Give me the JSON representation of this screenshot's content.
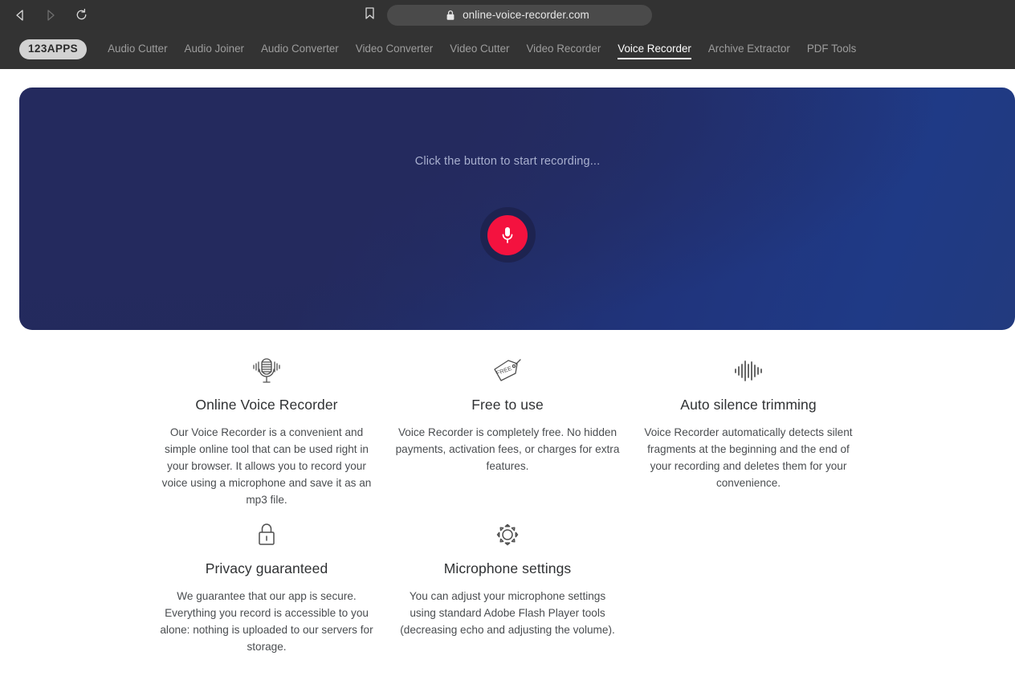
{
  "browser": {
    "back_icon": "back-arrow-icon",
    "forward_icon": "forward-arrow-icon",
    "reload_icon": "reload-icon",
    "bookmark_icon": "bookmark-icon",
    "lock_icon": "lock-icon",
    "url": "online-voice-recorder.com"
  },
  "site_nav": {
    "logo": "123APPS",
    "items": [
      {
        "label": "Audio Cutter",
        "active": false
      },
      {
        "label": "Audio Joiner",
        "active": false
      },
      {
        "label": "Audio Converter",
        "active": false
      },
      {
        "label": "Video Converter",
        "active": false
      },
      {
        "label": "Video Cutter",
        "active": false
      },
      {
        "label": "Video Recorder",
        "active": false
      },
      {
        "label": "Voice Recorder",
        "active": true
      },
      {
        "label": "Archive Extractor",
        "active": false
      },
      {
        "label": "PDF Tools",
        "active": false
      }
    ]
  },
  "hero": {
    "prompt": "Click the button to start recording...",
    "record_button_icon": "microphone-icon",
    "record_button_color": "#f4123f",
    "background_colors": [
      "#232a5d",
      "#1f3a86"
    ]
  },
  "features": {
    "row1": [
      {
        "icon": "studio-microphone-icon",
        "title": "Online Voice Recorder",
        "desc": "Our Voice Recorder is a convenient and simple online tool that can be used right in your browser. It allows you to record your voice using a microphone and save it as an mp3 file."
      },
      {
        "icon": "free-price-tag-icon",
        "icon_label": "FREE",
        "title": "Free to use",
        "desc": "Voice Recorder is completely free. No hidden payments, activation fees, or charges for extra features."
      },
      {
        "icon": "waveform-icon",
        "title": "Auto silence trimming",
        "desc": "Voice Recorder automatically detects silent fragments at the beginning and the end of your recording and deletes them for your convenience."
      }
    ],
    "row2": [
      {
        "icon": "padlock-icon",
        "title": "Privacy guaranteed",
        "desc": "We guarantee that our app is secure. Everything you record is accessible to you alone: nothing is uploaded to our servers for storage."
      },
      {
        "icon": "gear-icon",
        "title": "Microphone settings",
        "desc": "You can adjust your microphone settings using standard Adobe Flash Player tools (decreasing echo and adjusting the volume)."
      }
    ]
  }
}
